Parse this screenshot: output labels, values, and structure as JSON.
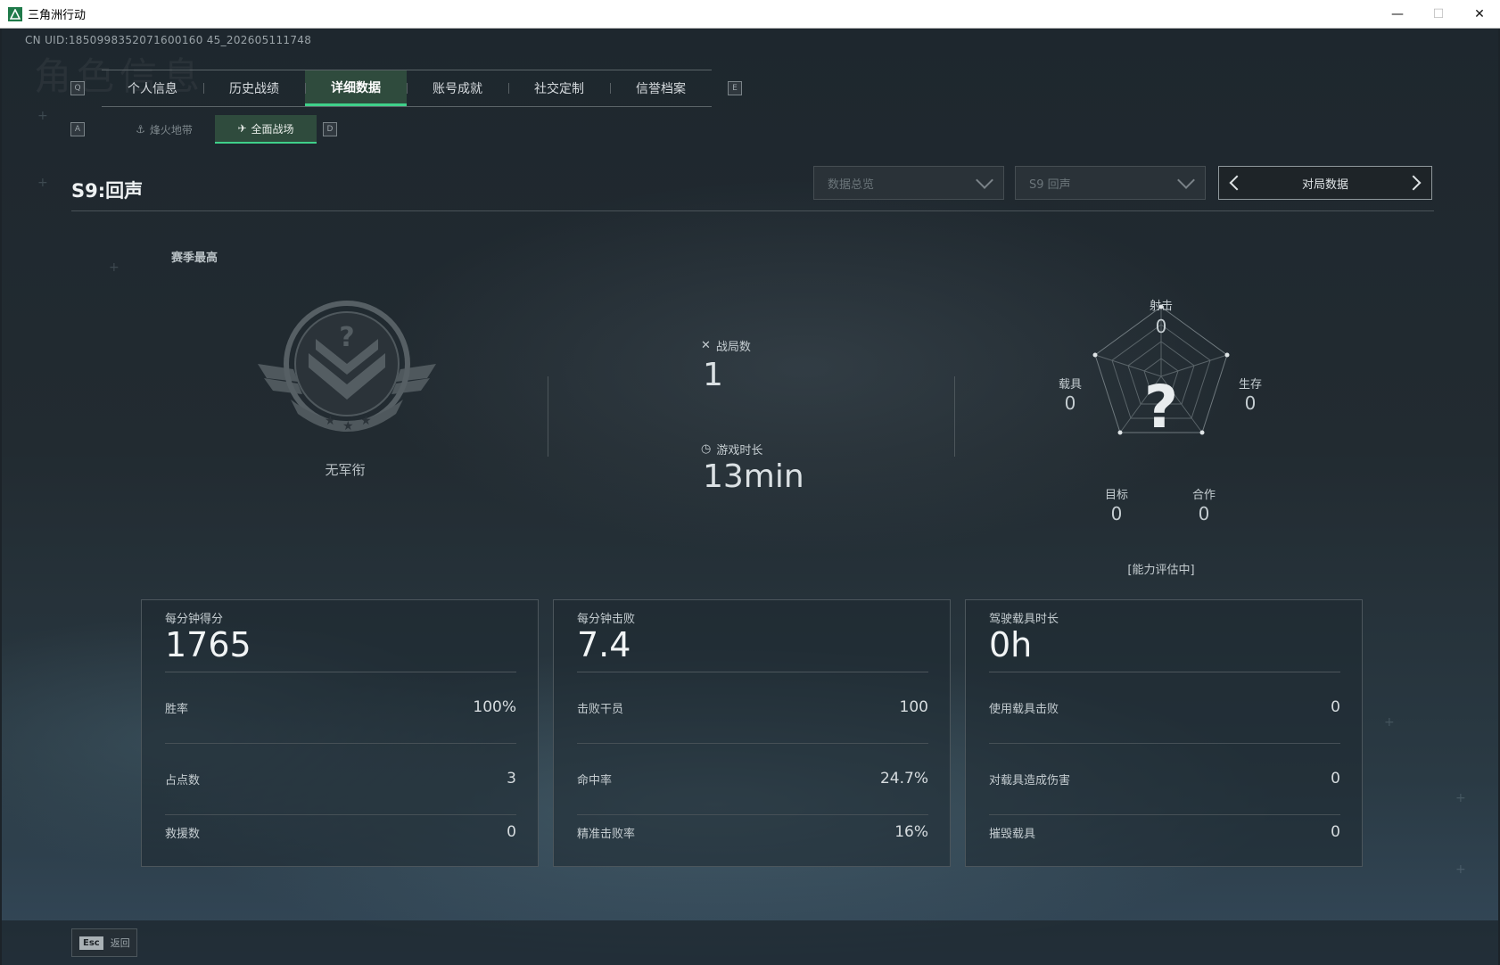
{
  "window": {
    "title": "三角洲行动",
    "minimize": "—",
    "maximize": "☐",
    "close": "✕"
  },
  "uid": "CN UID:1850998352071600160 45_202605111748",
  "bg_title": "角色信息",
  "tabs": {
    "hint_left": "Q",
    "hint_right": "E",
    "items": [
      {
        "label": "个人信息"
      },
      {
        "label": "历史战绩"
      },
      {
        "label": "详细数据",
        "active": true
      },
      {
        "label": "账号成就"
      },
      {
        "label": "社交定制"
      },
      {
        "label": "信誉档案"
      }
    ]
  },
  "subtabs": {
    "hint_left": "A",
    "hint_right": "D",
    "items": [
      {
        "label": "烽火地带",
        "icon": "operations-icon"
      },
      {
        "label": "全面战场",
        "icon": "warfare-icon",
        "active": true
      }
    ]
  },
  "season": {
    "title": "S9:回声",
    "best_label": "赛季最高",
    "rank_name": "无军衔"
  },
  "filters": {
    "overview": "数据总览",
    "season_select": "S9 回声",
    "pager_label": "对局数据"
  },
  "summary": {
    "matches_label": "战局数",
    "matches_value": "1",
    "playtime_label": "游戏时长",
    "playtime_value": "13min"
  },
  "radar": {
    "center_mark": "?",
    "axes": [
      {
        "label": "射击",
        "value": "0"
      },
      {
        "label": "生存",
        "value": "0"
      },
      {
        "label": "合作",
        "value": "0"
      },
      {
        "label": "目标",
        "value": "0"
      },
      {
        "label": "载具",
        "value": "0"
      }
    ],
    "status": "[能力评估中]"
  },
  "cards": [
    {
      "head_label": "每分钟得分",
      "head_value": "1765",
      "rows": [
        {
          "label": "胜率",
          "value": "100%"
        },
        {
          "label": "占点数",
          "value": "3"
        },
        {
          "label": "救援数",
          "value": "0"
        }
      ]
    },
    {
      "head_label": "每分钟击败",
      "head_value": "7.4",
      "rows": [
        {
          "label": "击败干员",
          "value": "100"
        },
        {
          "label": "命中率",
          "value": "24.7%"
        },
        {
          "label": "精准击败率",
          "value": "16%"
        }
      ]
    },
    {
      "head_label": "驾驶载具时长",
      "head_value": "0h",
      "rows": [
        {
          "label": "使用载具击败",
          "value": "0"
        },
        {
          "label": "对载具造成伤害",
          "value": "0"
        },
        {
          "label": "摧毁载具",
          "value": "0"
        }
      ]
    }
  ],
  "footer": {
    "esc_key": "Esc",
    "esc_label": "返回"
  },
  "colors": {
    "accent": "#3fd08a",
    "active_tab_bg": "#2f4b3d"
  }
}
